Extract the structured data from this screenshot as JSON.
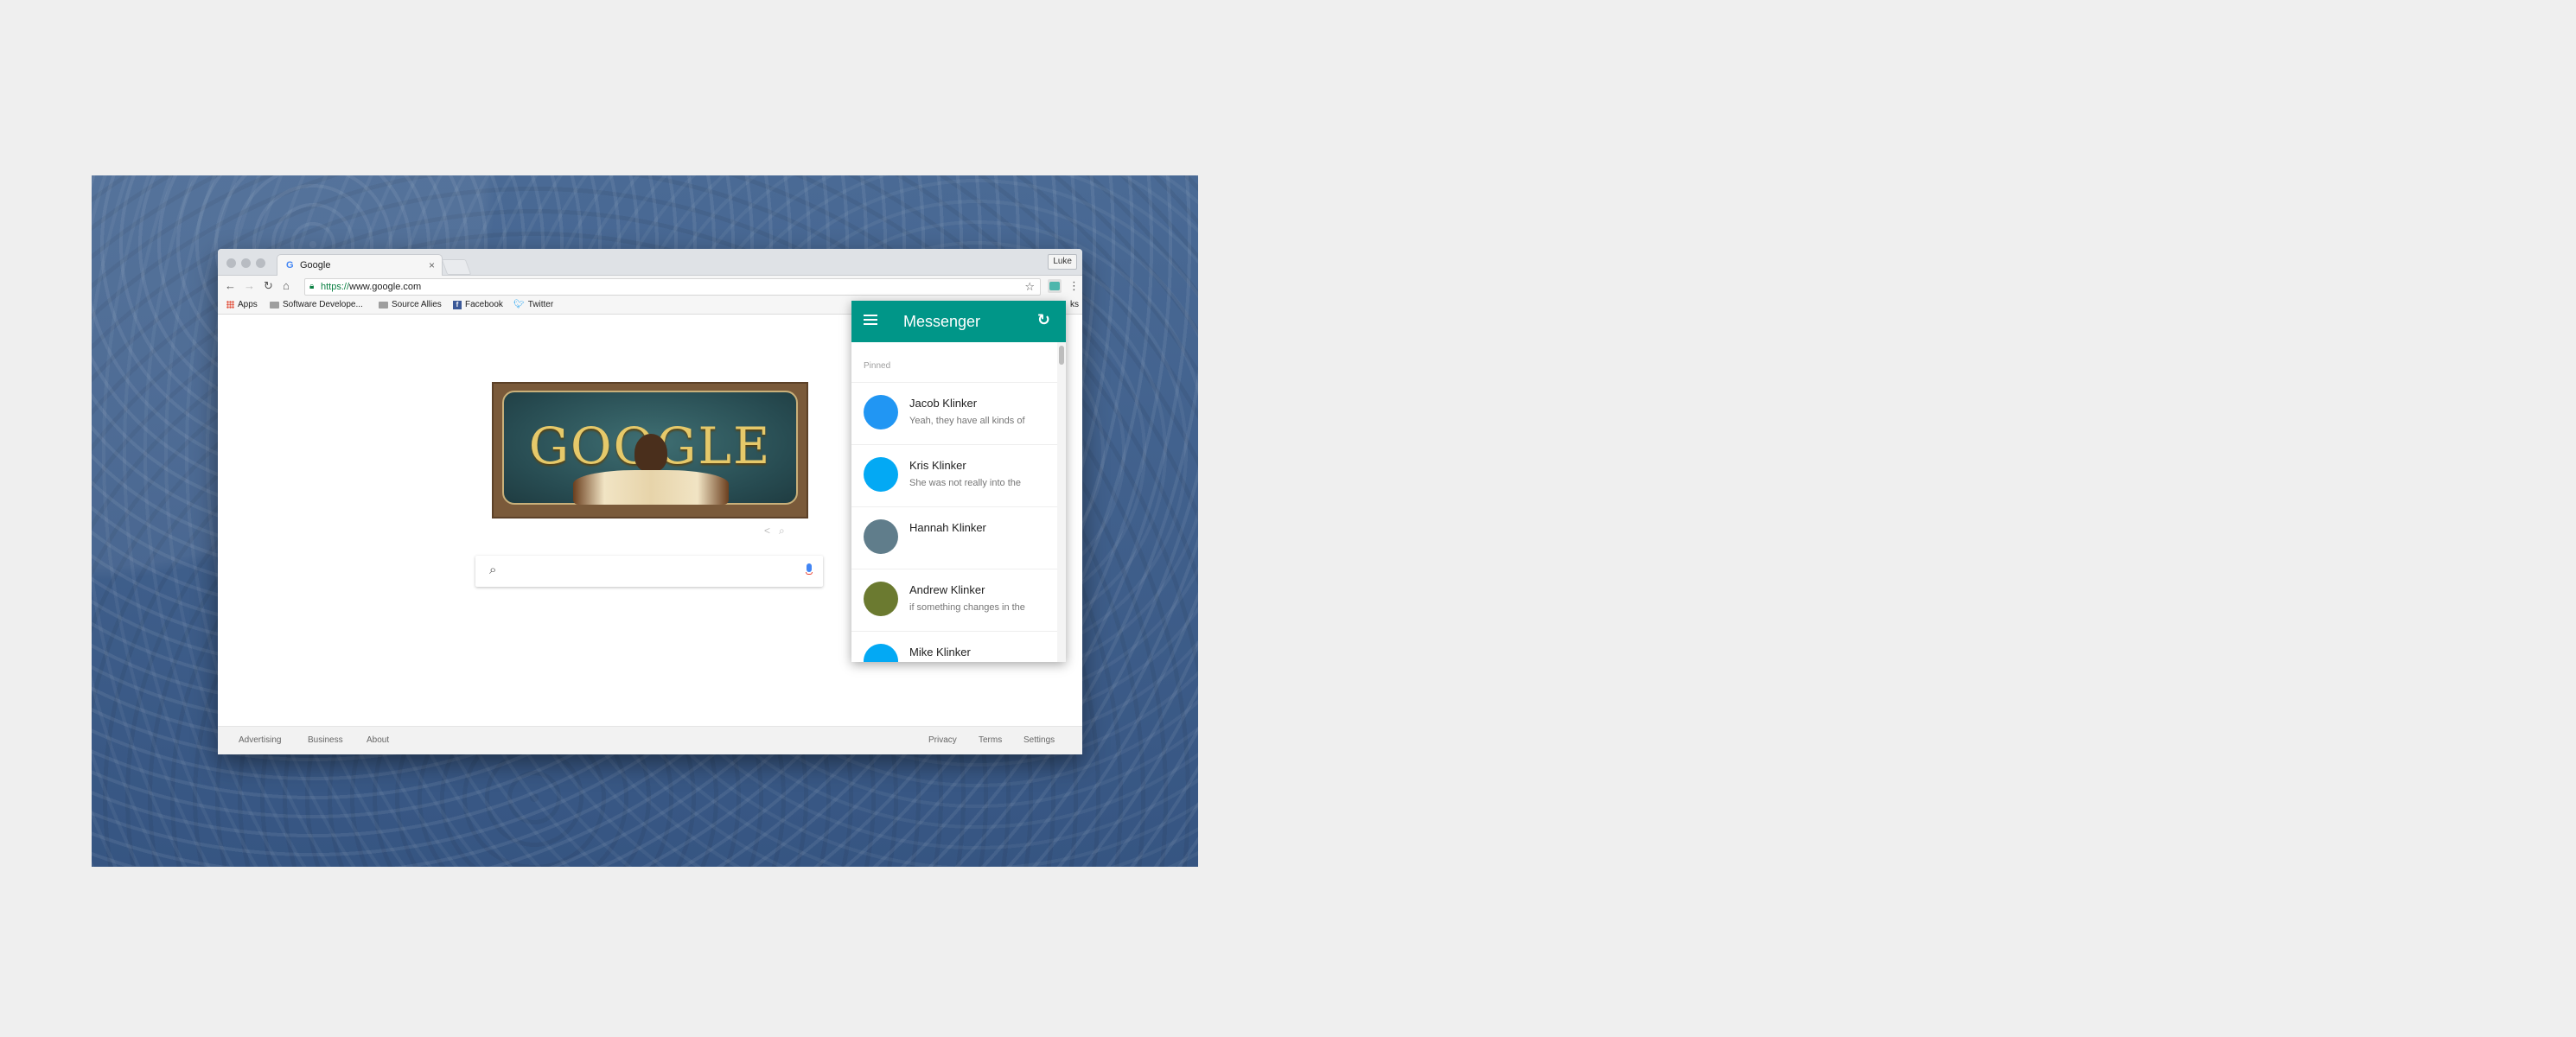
{
  "browser": {
    "tab_title": "Google",
    "tab_favicon": "G",
    "profile_name": "Luke",
    "url_scheme": "https://",
    "url_host": "www.google.com",
    "bookmarks": [
      {
        "label": "Apps",
        "icon": "apps-grid-icon"
      },
      {
        "label": "Software Develope...",
        "icon": "folder-icon"
      },
      {
        "label": "Source Allies",
        "icon": "folder-icon"
      },
      {
        "label": "Facebook",
        "icon": "facebook-icon"
      },
      {
        "label": "Twitter",
        "icon": "twitter-icon"
      }
    ],
    "bookmarks_overflow": "ks"
  },
  "google": {
    "doodle_text": "GOOGLE",
    "footer_left": [
      "Advertising",
      "Business",
      "About"
    ],
    "footer_right": [
      "Privacy",
      "Terms",
      "Settings"
    ]
  },
  "messenger": {
    "title": "Messenger",
    "accent_color": "#009688",
    "section_label": "Pinned",
    "conversations": [
      {
        "name": "Jacob Klinker",
        "preview": "Yeah, they have all kinds of",
        "avatar_color": "#2196f3"
      },
      {
        "name": "Kris Klinker",
        "preview": "She was not really into the",
        "avatar_color": "#03a9f4"
      },
      {
        "name": "Hannah Klinker",
        "preview": "",
        "avatar_color": "#607d8b"
      },
      {
        "name": "Andrew Klinker",
        "preview": "if something changes in the",
        "avatar_color": "#6b7a30"
      },
      {
        "name": "Mike Klinker",
        "preview": "",
        "avatar_color": "#03a9f4"
      }
    ]
  }
}
